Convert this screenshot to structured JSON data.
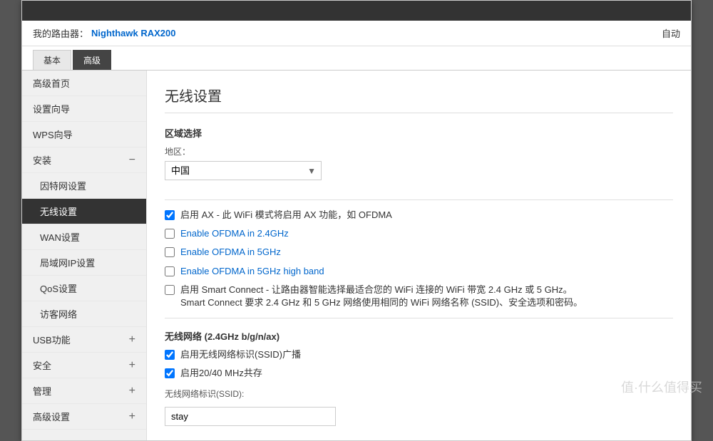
{
  "header": {
    "router_label": "我的路由器：",
    "router_name": "Nighthawk RAX200",
    "auto_label": "自动"
  },
  "tabs": [
    {
      "id": "basic",
      "label": "基本",
      "active": false
    },
    {
      "id": "advanced",
      "label": "高级",
      "active": true
    }
  ],
  "sidebar": {
    "items": [
      {
        "id": "advanced-home",
        "label": "高级首页",
        "indent": false,
        "has_plus": false,
        "has_minus": false,
        "active": false
      },
      {
        "id": "setup-wizard",
        "label": "设置向导",
        "indent": false,
        "has_plus": false,
        "has_minus": false,
        "active": false
      },
      {
        "id": "wps-wizard",
        "label": "WPS向导",
        "indent": false,
        "has_plus": false,
        "has_minus": false,
        "active": false
      },
      {
        "id": "install",
        "label": "安装",
        "indent": false,
        "has_plus": false,
        "has_minus": true,
        "active": false
      },
      {
        "id": "internet-settings",
        "label": "因特网设置",
        "indent": true,
        "has_plus": false,
        "has_minus": false,
        "active": false
      },
      {
        "id": "wireless-settings",
        "label": "无线设置",
        "indent": true,
        "has_plus": false,
        "has_minus": false,
        "active": true
      },
      {
        "id": "wan-settings",
        "label": "WAN设置",
        "indent": true,
        "has_plus": false,
        "has_minus": false,
        "active": false
      },
      {
        "id": "lan-ip-settings",
        "label": "局域网IP设置",
        "indent": true,
        "has_plus": false,
        "has_minus": false,
        "active": false
      },
      {
        "id": "qos-settings",
        "label": "QoS设置",
        "indent": true,
        "has_plus": false,
        "has_minus": false,
        "active": false
      },
      {
        "id": "guest-network",
        "label": "访客网络",
        "indent": true,
        "has_plus": false,
        "has_minus": false,
        "active": false
      },
      {
        "id": "usb",
        "label": "USB功能",
        "indent": false,
        "has_plus": true,
        "has_minus": false,
        "active": false
      },
      {
        "id": "security",
        "label": "安全",
        "indent": false,
        "has_plus": true,
        "has_minus": false,
        "active": false
      },
      {
        "id": "management",
        "label": "管理",
        "indent": false,
        "has_plus": true,
        "has_minus": false,
        "active": false
      },
      {
        "id": "advanced-settings",
        "label": "高级设置",
        "indent": false,
        "has_plus": true,
        "has_minus": false,
        "active": false
      }
    ]
  },
  "content": {
    "page_title": "无线设置",
    "region_section": "区域选择",
    "region_label": "地区：",
    "region_value": "中国",
    "checkboxes": [
      {
        "id": "ax-enable",
        "label": "启用 AX - 此 WiFi 模式将启用 AX 功能，如 OFDMA",
        "checked": true,
        "blue": false
      },
      {
        "id": "ofdma-2g",
        "label": "Enable OFDMA in 2.4GHz",
        "checked": false,
        "blue": true
      },
      {
        "id": "ofdma-5g",
        "label": "Enable OFDMA in 5GHz",
        "checked": false,
        "blue": true
      },
      {
        "id": "ofdma-5g-high",
        "label": "Enable OFDMA in 5GHz high band",
        "checked": false,
        "blue": true
      },
      {
        "id": "smart-connect",
        "label": "启用 Smart Connect - 让路由器智能选择最适合您的 WiFi 连接的 WiFi 带宽 2.4 GHz 或 5 GHz。Smart Connect 要求 2.4 GHz 和 5 GHz 网络使用相同的 WiFi 网络名称 (SSID)、安全选项和密码。",
        "checked": false,
        "blue": false
      }
    ],
    "wireless_section_title": "无线网络 (2.4GHz b/g/n/ax)",
    "wireless_checkboxes": [
      {
        "id": "ssid-broadcast",
        "label": "启用无线网络标识(SSID)广播",
        "checked": true
      },
      {
        "id": "coexistence",
        "label": "启用20/40 MHz共存",
        "checked": true
      }
    ],
    "ssid_label": "无线网络标识(SSID):",
    "ssid_value": "stay"
  },
  "watermark": "值·什么值得买"
}
